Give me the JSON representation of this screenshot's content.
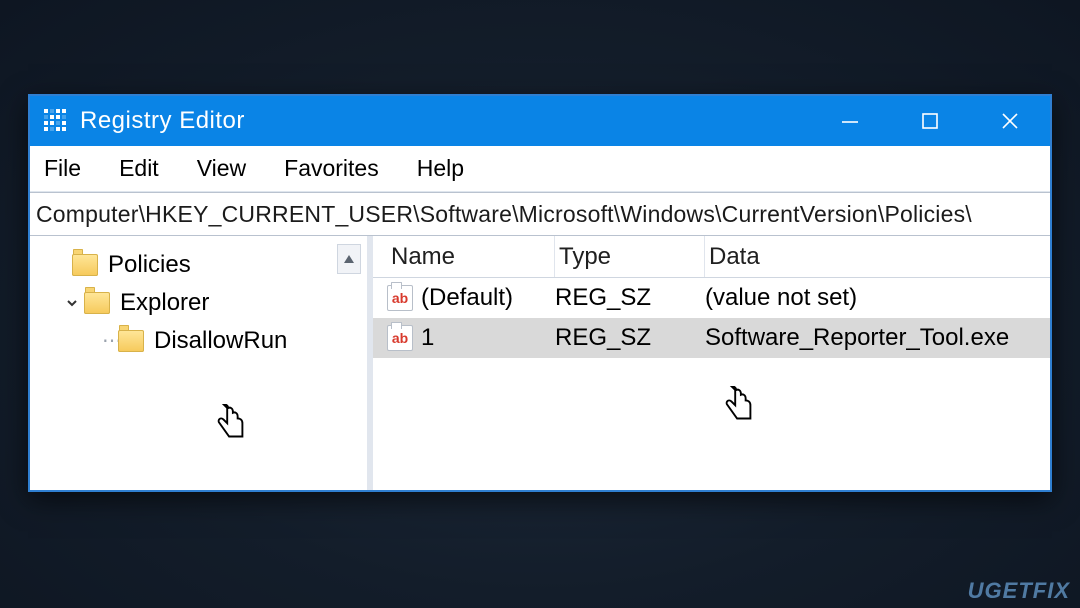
{
  "window": {
    "title": "Registry Editor"
  },
  "menu": {
    "file": "File",
    "edit": "Edit",
    "view": "View",
    "favorites": "Favorites",
    "help": "Help"
  },
  "address": "Computer\\HKEY_CURRENT_USER\\Software\\Microsoft\\Windows\\CurrentVersion\\Policies\\",
  "tree": {
    "policies": "Policies",
    "explorer": "Explorer",
    "disallowrun": "DisallowRun"
  },
  "columns": {
    "name": "Name",
    "type": "Type",
    "data": "Data"
  },
  "values": [
    {
      "icon": "ab",
      "name": "(Default)",
      "type": "REG_SZ",
      "data": "(value not set)",
      "selected": false
    },
    {
      "icon": "ab",
      "name": "1",
      "type": "REG_SZ",
      "data": "Software_Reporter_Tool.exe",
      "selected": true
    }
  ],
  "watermark": "UGETFIX"
}
